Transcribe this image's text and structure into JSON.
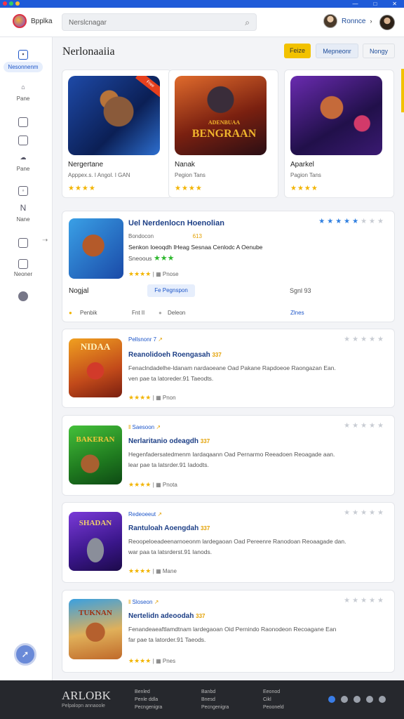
{
  "window": {
    "min": "—",
    "max": "□",
    "close": "✕"
  },
  "header": {
    "app_name": "Bpplka",
    "search_placeholder": "Nerslcnagar",
    "user_name": "Ronnce",
    "user_chevron": "›"
  },
  "sidebar": {
    "items": [
      {
        "label": "Nesonnenm",
        "icon": "store-icon"
      },
      {
        "label": "Pane",
        "icon": "home-icon"
      },
      {
        "label": "",
        "icon": "square-icon"
      },
      {
        "label": "",
        "icon": "image-icon"
      },
      {
        "label": "Pane",
        "icon": "cloud-icon"
      },
      {
        "label": "",
        "icon": "gamepad-icon"
      },
      {
        "label": "Nane",
        "icon": "n-icon"
      },
      {
        "label": "",
        "icon": "page-icon"
      },
      {
        "label": "Neoner",
        "icon": "photo-icon"
      },
      {
        "label": "",
        "icon": "globe-icon"
      }
    ]
  },
  "page": {
    "title": "Nerlonaaiia",
    "buttons": [
      "Feize",
      "Mepneonr",
      "Nongy"
    ]
  },
  "featured": [
    {
      "title": "Nergertane",
      "sub": "Apppex.s. I Angol. I GAN",
      "stars": "★★★★",
      "badge": "Free"
    },
    {
      "title": "Nanak",
      "sub": "Pegion Tans",
      "stars": "★★★★",
      "logo": "BENGRAAN",
      "logo_top": "ADENBUAA"
    },
    {
      "title": "Aparkel",
      "sub": "Pagion Tans",
      "stars": "★★★★"
    }
  ],
  "feature_card": {
    "title": "Uel Nerdenlocn Hoenolian",
    "genre": "Bondocon",
    "price": "613",
    "line3": "Senkon Ioeoqdh IHeag Sesnaa Cenlodc A Oenube",
    "line4": "Sneoous",
    "line4_stars": "★★★",
    "stars": "★★★★",
    "platform": "Pnose",
    "name": "Nogjal",
    "button": "Fe Pegnspon",
    "size": "Sgnl 93",
    "meta1": "Penbik",
    "meta2": "Fnt  II",
    "meta3": "Deleon",
    "meta4": "Zlnes",
    "rating_display": "★★★★★★★"
  },
  "cards": [
    {
      "category": "Pellsnonr 7",
      "title": "Reanolidoeh Roengasah",
      "num": "337",
      "desc1": "Fenaclndadelhe-ldanam  nardaoeane  Oad  Pakane  Rapdoeoe  Raongazan  Ean.",
      "desc2": "ven pae ta latoreder.91 Taeodts.",
      "stars": "★★★★",
      "platform": "Pnon",
      "logo": "NIDAA"
    },
    {
      "category": "Saesoon",
      "title": "Nerlaritanio  odeagdh",
      "num": "337",
      "desc1": "Hegenfadersatedmenm  Iardaqaann  Oad  Pernarmo  Reeadoen  Reoagade  aan.",
      "desc2": "lear pae ta latsrder.91 Iadodts.",
      "stars": "★★★★",
      "platform": "Pnota",
      "logo": "BAKERAN"
    },
    {
      "category": "Redeoeeut",
      "title": "Rantuloah  Aoengdah",
      "num": "337",
      "desc1": "Reoopeloeadeenarnoeonm  lardegaoan  Oad  Pereenre  Ranodoan  Reoaagade  dan.",
      "desc2": "war paa ta latsrderst.91 Ianods.",
      "stars": "★★★★",
      "platform": "Mane",
      "logo": "SHADAN"
    },
    {
      "category": "Sloseon",
      "title": "Nertelidn  adeoodah",
      "num": "337",
      "desc1": "Fenandeaeaftlamdtnam  lardegaoan  Oid  Pernindo  Raonodeon  Recoagane  Ean",
      "desc2": "far pae ta latorder.91 Taeods.",
      "stars": "★★★★",
      "platform": "Pnes",
      "logo": "TUKNAN"
    }
  ],
  "footer": {
    "logo": "ARLOBK",
    "tagline": "Pelpalopn annaoole",
    "col1": [
      "Benled",
      "Penle ddla",
      "Pecngenigra"
    ],
    "col2": [
      "Banbd",
      "Bnesd",
      "Pecngenigra"
    ],
    "col3": [
      "Eeonod",
      "Cikl",
      "Peooneld"
    ]
  },
  "colors": {
    "accent": "#1d56c9",
    "star": "#f2b400",
    "footer": "#26282d",
    "topbar": "#1f5bd8"
  }
}
